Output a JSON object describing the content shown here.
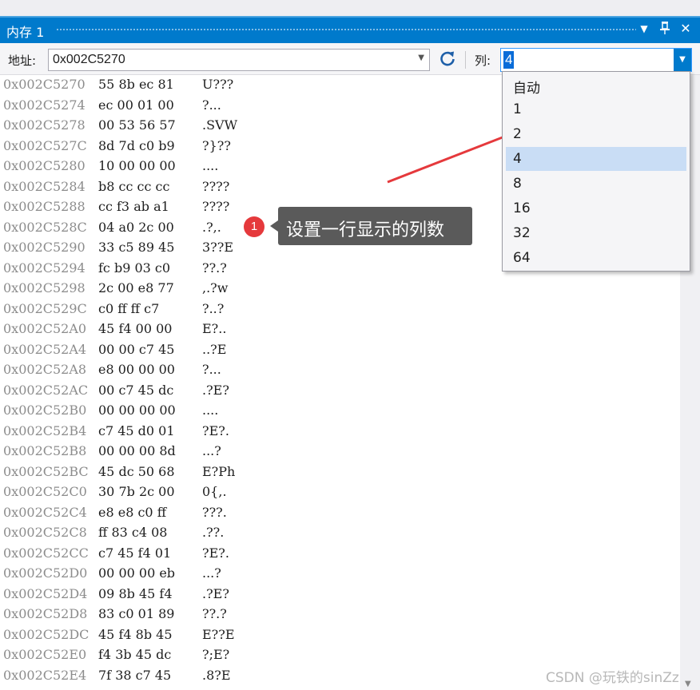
{
  "window": {
    "title": "内存 1",
    "pin_glyph": "📌",
    "close_glyph": "✕",
    "menu_glyph": "▼"
  },
  "toolbar": {
    "address_label": "地址:",
    "address_value": "0x002C5270",
    "columns_label": "列:",
    "columns_value": "4"
  },
  "columns_dropdown": {
    "options": [
      "自动",
      "1",
      "2",
      "4",
      "8",
      "16",
      "32",
      "64"
    ],
    "selected": "4"
  },
  "memory_rows": [
    {
      "addr": "0x002C5270",
      "bytes": "55 8b ec 81",
      "ascii": "U???"
    },
    {
      "addr": "0x002C5274",
      "bytes": "ec 00 01 00",
      "ascii": "?..."
    },
    {
      "addr": "0x002C5278",
      "bytes": "00 53 56 57",
      "ascii": ".SVW"
    },
    {
      "addr": "0x002C527C",
      "bytes": "8d 7d c0 b9",
      "ascii": "?}??"
    },
    {
      "addr": "0x002C5280",
      "bytes": "10 00 00 00",
      "ascii": "...."
    },
    {
      "addr": "0x002C5284",
      "bytes": "b8 cc cc cc",
      "ascii": "????"
    },
    {
      "addr": "0x002C5288",
      "bytes": "cc f3 ab a1",
      "ascii": "????"
    },
    {
      "addr": "0x002C528C",
      "bytes": "04 a0 2c 00",
      "ascii": ".?,."
    },
    {
      "addr": "0x002C5290",
      "bytes": "33 c5 89 45",
      "ascii": "3??E"
    },
    {
      "addr": "0x002C5294",
      "bytes": "fc b9 03 c0",
      "ascii": "??.?"
    },
    {
      "addr": "0x002C5298",
      "bytes": "2c 00 e8 77",
      "ascii": ",.?w"
    },
    {
      "addr": "0x002C529C",
      "bytes": "c0 ff ff c7",
      "ascii": "?..?"
    },
    {
      "addr": "0x002C52A0",
      "bytes": "45 f4 00 00",
      "ascii": "E?.."
    },
    {
      "addr": "0x002C52A4",
      "bytes": "00 00 c7 45",
      "ascii": "..?E"
    },
    {
      "addr": "0x002C52A8",
      "bytes": "e8 00 00 00",
      "ascii": "?..."
    },
    {
      "addr": "0x002C52AC",
      "bytes": "00 c7 45 dc",
      "ascii": ".?E?"
    },
    {
      "addr": "0x002C52B0",
      "bytes": "00 00 00 00",
      "ascii": "...."
    },
    {
      "addr": "0x002C52B4",
      "bytes": "c7 45 d0 01",
      "ascii": "?E?."
    },
    {
      "addr": "0x002C52B8",
      "bytes": "00 00 00 8d",
      "ascii": "...?"
    },
    {
      "addr": "0x002C52BC",
      "bytes": "45 dc 50 68",
      "ascii": "E?Ph"
    },
    {
      "addr": "0x002C52C0",
      "bytes": "30 7b 2c 00",
      "ascii": "0{,."
    },
    {
      "addr": "0x002C52C4",
      "bytes": "e8 e8 c0 ff",
      "ascii": "???."
    },
    {
      "addr": "0x002C52C8",
      "bytes": "ff 83 c4 08",
      "ascii": ".??."
    },
    {
      "addr": "0x002C52CC",
      "bytes": "c7 45 f4 01",
      "ascii": "?E?."
    },
    {
      "addr": "0x002C52D0",
      "bytes": "00 00 00 eb",
      "ascii": "...?"
    },
    {
      "addr": "0x002C52D4",
      "bytes": "09 8b 45 f4",
      "ascii": ".?E?"
    },
    {
      "addr": "0x002C52D8",
      "bytes": "83 c0 01 89",
      "ascii": "??.?"
    },
    {
      "addr": "0x002C52DC",
      "bytes": "45 f4 8b 45",
      "ascii": "E??E"
    },
    {
      "addr": "0x002C52E0",
      "bytes": "f4 3b 45 dc",
      "ascii": "?;E?"
    },
    {
      "addr": "0x002C52E4",
      "bytes": "7f 38 c7 45",
      "ascii": ".8?E"
    }
  ],
  "annotation": {
    "badge": "1",
    "text": "设置一行显示的列数",
    "color": "#e5393c"
  },
  "watermark": "CSDN @玩铁的sinZz"
}
